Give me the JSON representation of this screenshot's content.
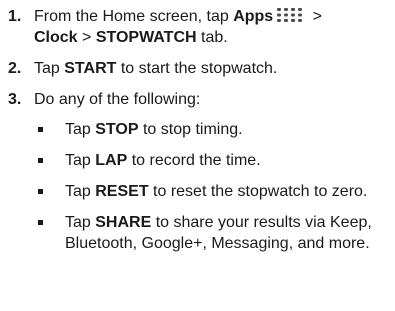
{
  "steps": [
    {
      "number": "1.",
      "parts": {
        "a": "From the Home screen, tap ",
        "apps": "Apps",
        "b": " > ",
        "clock": "Clock",
        "c": " > ",
        "stopwatch": "STOPWATCH",
        "d": " tab."
      },
      "icon": "apps-grid-icon"
    },
    {
      "number": "2.",
      "parts": {
        "a": "Tap ",
        "start": "START",
        "b": " to start the stopwatch."
      }
    },
    {
      "number": "3.",
      "text": "Do any of the following:",
      "bullets": [
        {
          "a": "Tap ",
          "kw": "STOP",
          "b": " to stop timing."
        },
        {
          "a": "Tap ",
          "kw": "LAP",
          "b": " to record the time."
        },
        {
          "a": "Tap ",
          "kw": "RESET",
          "b": " to reset the stopwatch to zero."
        },
        {
          "a": "Tap ",
          "kw": "SHARE",
          "b": " to share your results via Keep, Bluetooth, Google+, Messaging, and more."
        }
      ]
    }
  ]
}
